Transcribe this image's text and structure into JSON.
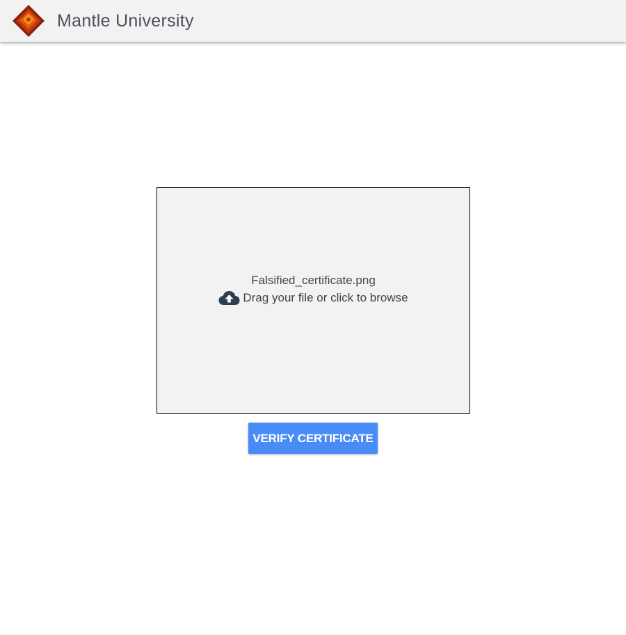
{
  "header": {
    "title": "Mantle University",
    "logo_icon": "diamond-logo-icon",
    "background_color": "#f2f2f2"
  },
  "upload": {
    "file_name": "Falsified_certificate.png",
    "hint": "Drag your file or click to browse",
    "icon": "cloud-upload-icon",
    "background_color": "#f2f2f2"
  },
  "actions": {
    "verify_label": "VERIFY CERTIFICATE",
    "verify_color": "#4a8cf7"
  }
}
